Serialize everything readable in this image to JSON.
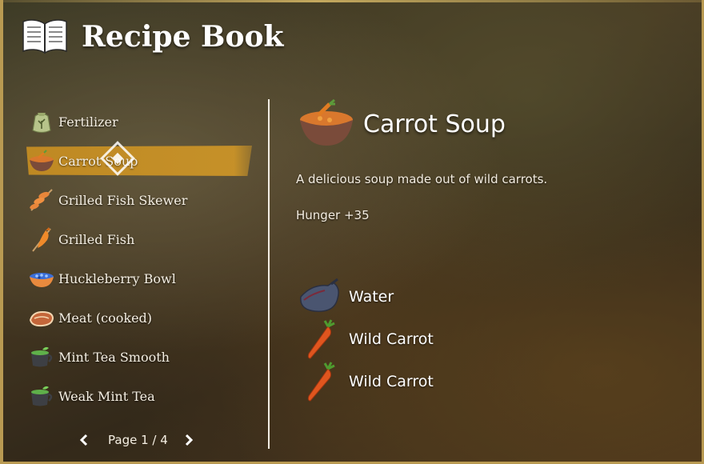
{
  "header": {
    "title": "Recipe Book",
    "icon": "open-book-icon"
  },
  "recipes": [
    {
      "label": "Fertilizer",
      "icon": "fertilizer-sack-icon",
      "selected": false
    },
    {
      "label": "Carrot Soup",
      "icon": "soup-bowl-icon",
      "selected": true
    },
    {
      "label": "Grilled Fish Skewer",
      "icon": "fish-skewer-icon",
      "selected": false
    },
    {
      "label": "Grilled Fish",
      "icon": "grilled-fish-icon",
      "selected": false
    },
    {
      "label": "Huckleberry Bowl",
      "icon": "berry-bowl-icon",
      "selected": false
    },
    {
      "label": "Meat (cooked)",
      "icon": "cooked-meat-icon",
      "selected": false
    },
    {
      "label": "Mint Tea Smooth",
      "icon": "mint-tea-icon",
      "selected": false
    },
    {
      "label": "Weak Mint Tea",
      "icon": "mint-tea-icon",
      "selected": false
    }
  ],
  "pager": {
    "text": "Page 1 / 4"
  },
  "detail": {
    "title": "Carrot Soup",
    "icon": "soup-bowl-icon",
    "description": "A delicious soup made out of wild carrots.",
    "stat": "Hunger +35",
    "ingredients": [
      {
        "label": "Water",
        "icon": "water-skin-icon"
      },
      {
        "label": "Wild Carrot",
        "icon": "carrot-icon"
      },
      {
        "label": "Wild Carrot",
        "icon": "carrot-icon"
      }
    ]
  },
  "colors": {
    "selected": "#c48c22",
    "frame": "#b99a52",
    "text": "#f5efe3"
  }
}
